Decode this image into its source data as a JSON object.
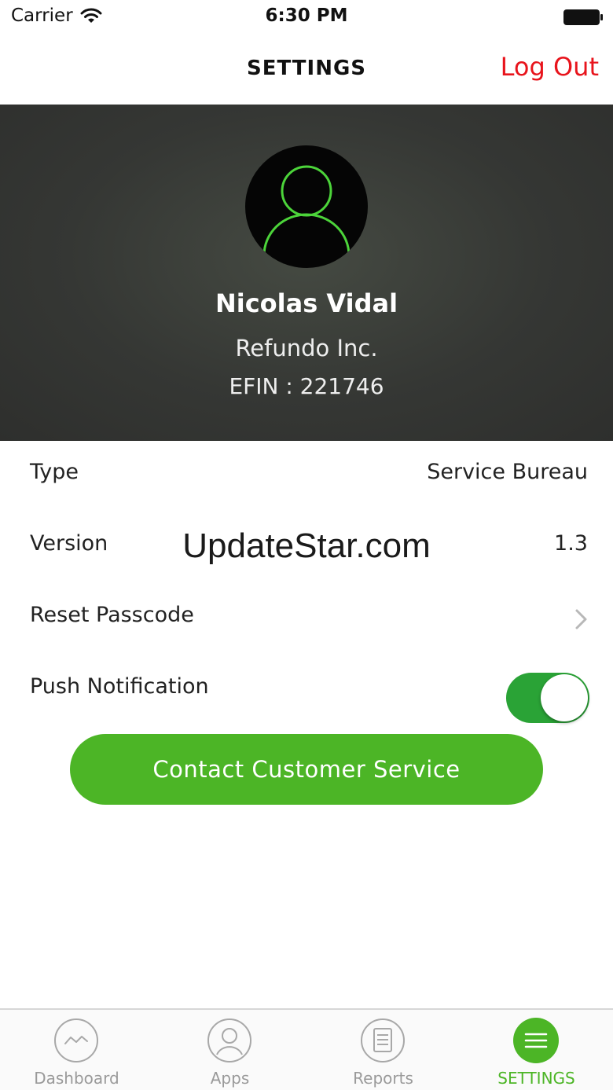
{
  "status_bar": {
    "carrier": "Carrier",
    "time": "6:30 PM"
  },
  "nav": {
    "title": "SETTINGS",
    "logout_label": "Log Out"
  },
  "profile": {
    "name": "Nicolas Vidal",
    "company": "Refundo Inc.",
    "efin": "EFIN : 221746"
  },
  "settings": {
    "type_label": "Type",
    "type_value": "Service Bureau",
    "version_label": "Version",
    "version_value": "1.3",
    "reset_passcode_label": "Reset Passcode",
    "push_notification_label": "Push Notification",
    "push_notification_enabled": true
  },
  "watermark": "UpdateStar.com",
  "contact_button_label": "Contact Customer Service",
  "tabs": [
    {
      "label": "Dashboard",
      "icon": "dashboard-icon",
      "active": false
    },
    {
      "label": "Apps",
      "icon": "apps-icon",
      "active": false
    },
    {
      "label": "Reports",
      "icon": "reports-icon",
      "active": false
    },
    {
      "label": "SETTINGS",
      "icon": "settings-menu-icon",
      "active": true
    }
  ],
  "colors": {
    "accent_green": "#4cb526",
    "toggle_green": "#2aa336",
    "logout_red": "#e8141c",
    "header_bg": "#353734",
    "avatar_outline": "#4cd43a"
  }
}
